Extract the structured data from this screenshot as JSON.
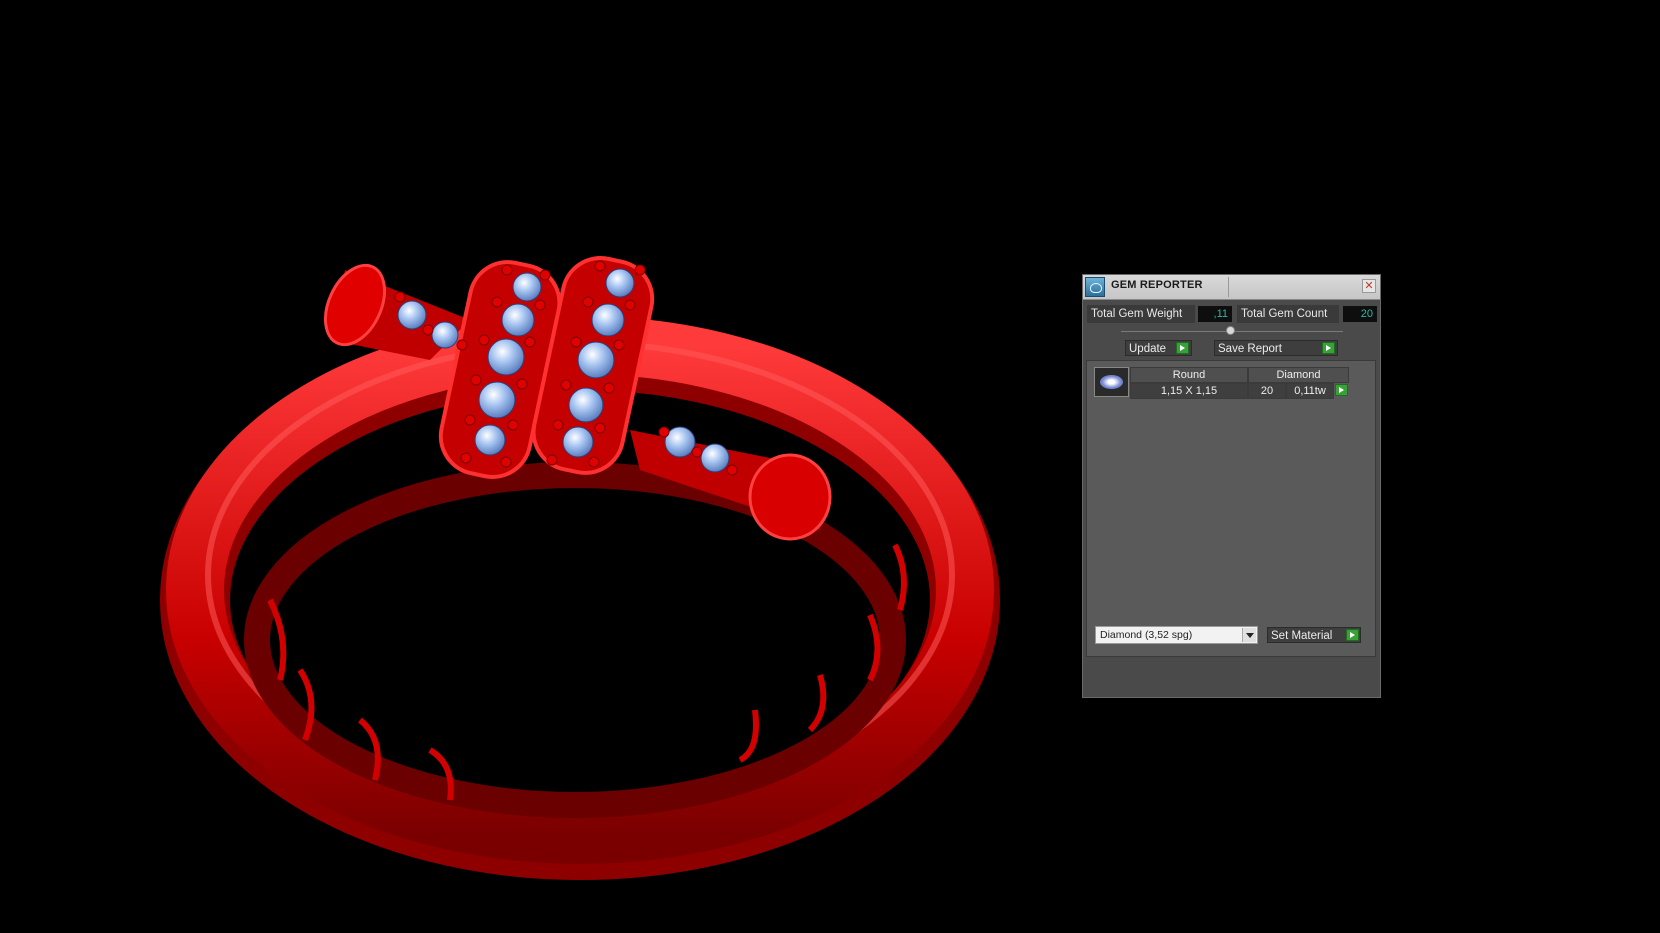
{
  "viewport": {
    "background": "#000000",
    "model_color": "#d40000",
    "gem_color": "#8fb3e8"
  },
  "gem_reporter": {
    "title": "GEM REPORTER",
    "total_gem_weight_label": "Total Gem Weight",
    "total_gem_weight_value": ",11",
    "total_gem_count_label": "Total Gem Count",
    "total_gem_count_value": "20",
    "update_label": "Update",
    "save_report_label": "Save Report",
    "gem_list": {
      "headers": [
        "Round",
        "Diamond"
      ],
      "rows": [
        {
          "size": "1,15 X 1,15",
          "count": "20",
          "weight": "0,11tw"
        }
      ]
    },
    "material_select": {
      "value": "Diamond    (3,52 spg)"
    },
    "set_material_label": "Set Material",
    "accent_color": "#3aa13a",
    "value_color": "#2fb7a4"
  }
}
